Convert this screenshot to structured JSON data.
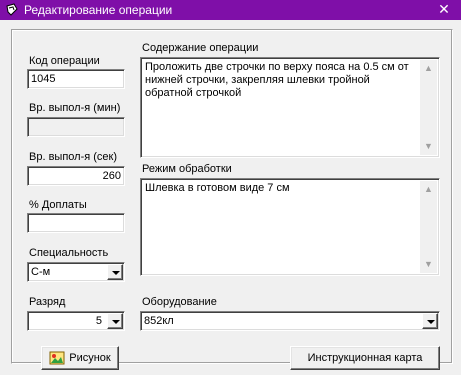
{
  "window": {
    "title": "Редактирование операции",
    "close_glyph": "✕",
    "app_icon": "cursor-app-icon"
  },
  "form": {
    "code_label": "Код операции",
    "code_value": "1045",
    "time_min_label": "Вр. выпол-я (мин)",
    "time_min_value": "",
    "time_sec_label": "Вр. выпол-я (сек)",
    "time_sec_value": "260",
    "bonus_label": "% Доплаты",
    "bonus_value": "",
    "specialty_label": "Специальность",
    "specialty_value": "С-м",
    "grade_label": "Разряд",
    "grade_value": "5",
    "content_label": "Содержание операции",
    "content_value": "Проложить две строчки по верху пояса на 0.5 см от нижней строчки, закрепляя шлевки тройной обратной строчкой",
    "mode_label": "Режим обработки",
    "mode_value": "Шлевка в готовом виде 7 см",
    "equipment_label": "Оборудование",
    "equipment_value": "852кл"
  },
  "buttons": {
    "picture_label": "Рисунок",
    "instruction_label": "Инструкционная карта"
  }
}
